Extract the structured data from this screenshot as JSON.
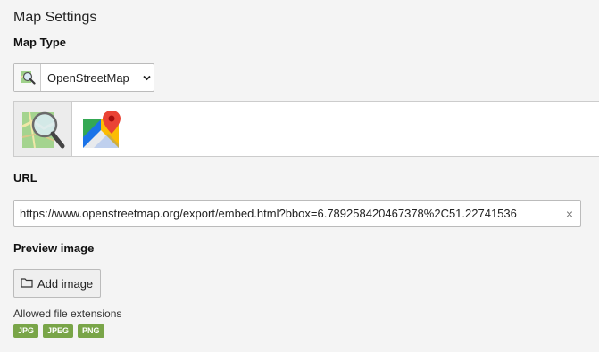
{
  "section": {
    "title": "Map Settings"
  },
  "map_type": {
    "label": "Map Type",
    "selected": "OpenStreetMap",
    "options": [
      "OpenStreetMap",
      "Google Maps"
    ],
    "icons": [
      "openstreetmap-icon",
      "google-maps-icon"
    ]
  },
  "url": {
    "label": "URL",
    "value": "https://www.openstreetmap.org/export/embed.html?bbox=6.789258420467378%2C51.22741536",
    "clear_icon": "×"
  },
  "preview": {
    "label": "Preview image",
    "add_button": "Add image",
    "allowed_label": "Allowed file extensions",
    "extensions": [
      "JPG",
      "JPEG",
      "PNG"
    ]
  },
  "colors": {
    "background": "#f4f4f4",
    "badge": "#79a548"
  }
}
